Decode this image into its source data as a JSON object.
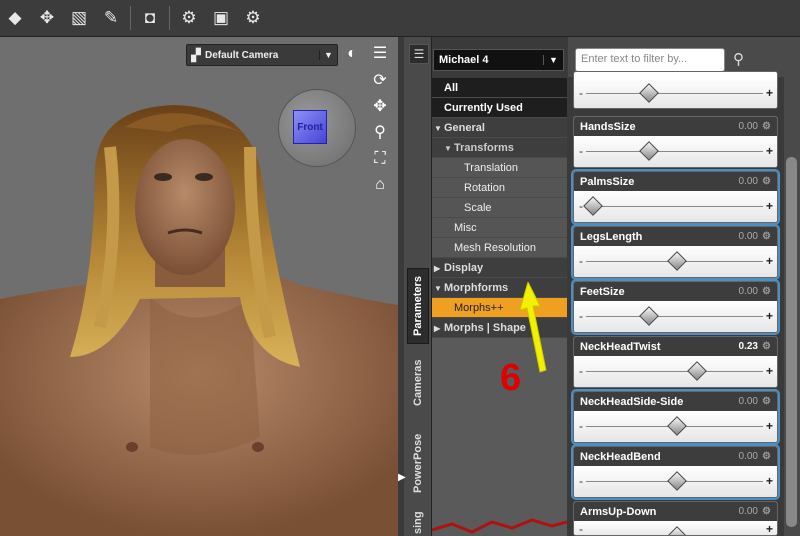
{
  "toolbar": {
    "icons": [
      "partial-icon",
      "transform-icon",
      "fill-icon",
      "edit-icon",
      "camera-capture-icon",
      "settings-icon",
      "render-icon",
      "render-settings-icon"
    ]
  },
  "viewport": {
    "camera_label": "Default Camera",
    "cube_label": "Front"
  },
  "side_tabs": [
    "Parameters",
    "Cameras",
    "PowerPose",
    "sing"
  ],
  "figure_select": "Michael 4",
  "filter_placeholder": "Enter text to filter by...",
  "tree": {
    "all": "All",
    "currently_used": "Currently Used",
    "general": "General",
    "transforms": "Transforms",
    "translation": "Translation",
    "rotation": "Rotation",
    "scale": "Scale",
    "misc": "Misc",
    "mesh_resolution": "Mesh Resolution",
    "display": "Display",
    "morphforms": "Morphforms",
    "morphs_pp": "Morphs++",
    "morphs_shape": "Morphs | Shape"
  },
  "params": [
    {
      "name": "HandsSize",
      "value": "0.00"
    },
    {
      "name": "PalmsSize",
      "value": "0.00"
    },
    {
      "name": "LegsLength",
      "value": "0.00"
    },
    {
      "name": "FeetSize",
      "value": "0.00"
    },
    {
      "name": "NeckHeadTwist",
      "value": "0.23"
    },
    {
      "name": "NeckHeadSide-Side",
      "value": "0.00"
    },
    {
      "name": "NeckHeadBend",
      "value": "0.00"
    },
    {
      "name": "ArmsUp-Down",
      "value": "0.00"
    }
  ],
  "annotation_number": "6",
  "colors": {
    "selection": "#f0a020",
    "highlight_border": "#4a8fc6",
    "annotation": "#e00000"
  }
}
